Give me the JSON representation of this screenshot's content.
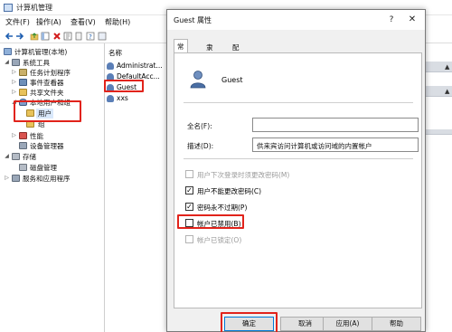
{
  "window": {
    "title": "计算机管理"
  },
  "menu": {
    "file": "文件(F)",
    "action": "操作(A)",
    "view": "查看(V)",
    "help": "帮助(H)"
  },
  "tree": {
    "root": "计算机管理(本地)",
    "system_tools": "系统工具",
    "task_scheduler": "任务计划程序",
    "event_viewer": "事件查看器",
    "shared_folders": "共享文件夹",
    "local_users_groups": "本地用户和组",
    "users": "用户",
    "groups": "组",
    "performance": "性能",
    "device_manager": "设备管理器",
    "storage": "存储",
    "disk_management": "磁盘管理",
    "services_apps": "服务和应用程序"
  },
  "list": {
    "header": "名称",
    "items": [
      "Administrat...",
      "DefaultAcc...",
      "Guest",
      "xxs"
    ]
  },
  "dialog": {
    "title": "Guest 属性",
    "help_glyph": "?",
    "close_glyph": "✕",
    "tabs": [
      "常规",
      "隶属于",
      "配置文件"
    ],
    "username": "Guest",
    "fullname_label": "全名(F):",
    "fullname_value": "",
    "description_label": "描述(D):",
    "description_value": "供来宾访问计算机或访问域的内置帐户",
    "checkboxes": [
      {
        "label": "用户下次登录时须更改密码(M)",
        "checked": false,
        "enabled": false,
        "mark": ""
      },
      {
        "label": "用户不能更改密码(C)",
        "checked": true,
        "enabled": true,
        "mark": "✓"
      },
      {
        "label": "密码永不过期(P)",
        "checked": true,
        "enabled": true,
        "mark": "✓"
      },
      {
        "label": "帐户已禁用(B)",
        "checked": false,
        "enabled": true,
        "mark": ""
      },
      {
        "label": "帐户已锁定(O)",
        "checked": false,
        "enabled": false,
        "mark": ""
      }
    ],
    "buttons": {
      "ok": "确定",
      "cancel": "取消",
      "apply": "应用(A)",
      "help": "帮助"
    }
  },
  "colors": {
    "highlight": "#e1231b",
    "accent": "#0078d7"
  }
}
